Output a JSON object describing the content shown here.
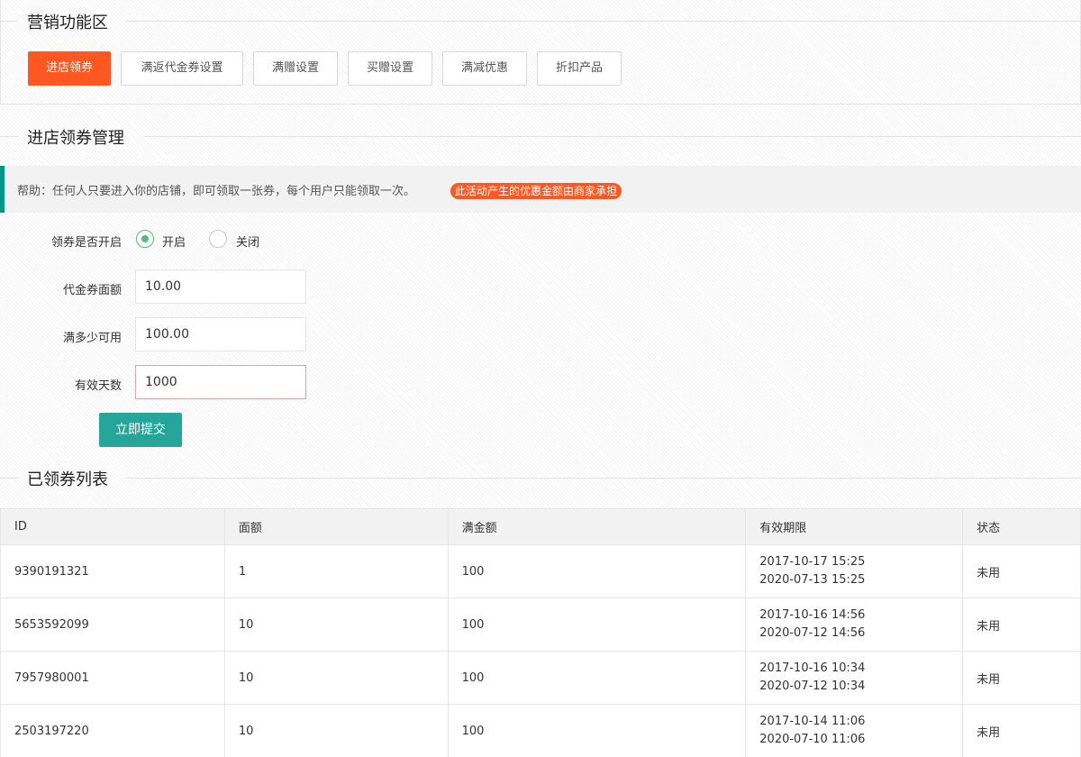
{
  "marketing": {
    "title": "营销功能区",
    "buttons": [
      {
        "label": "进店领券",
        "active": true
      },
      {
        "label": "满返代金券设置",
        "active": false
      },
      {
        "label": "满赠设置",
        "active": false
      },
      {
        "label": "买赠设置",
        "active": false
      },
      {
        "label": "满减优惠",
        "active": false
      },
      {
        "label": "折扣产品",
        "active": false
      }
    ]
  },
  "management": {
    "title": "进店领券管理",
    "help_text": "帮助：任何人只要进入你的店铺，即可领取一张券，每个用户只能领取一次。",
    "help_badge": "此活动产生的优惠金额由商家承担"
  },
  "form": {
    "enable_label": "领券是否开启",
    "option_on": "开启",
    "option_off": "关闭",
    "selected": "开启",
    "face_value_label": "代金券面额",
    "face_value": "10.00",
    "min_amount_label": "满多少可用",
    "min_amount": "100.00",
    "valid_days_label": "有效天数",
    "valid_days": "1000",
    "submit_label": "立即提交"
  },
  "coupon_list": {
    "title": "已领券列表",
    "columns": [
      "ID",
      "面额",
      "满金额",
      "有效期限",
      "状态"
    ],
    "rows": [
      {
        "id": "9390191321",
        "face": "1",
        "min": "100",
        "start": "2017-10-17 15:25",
        "end": "2020-07-13 15:25",
        "status": "未用"
      },
      {
        "id": "5653592099",
        "face": "10",
        "min": "100",
        "start": "2017-10-16 14:56",
        "end": "2020-07-12 14:56",
        "status": "未用"
      },
      {
        "id": "7957980001",
        "face": "10",
        "min": "100",
        "start": "2017-10-16 10:34",
        "end": "2020-07-12 10:34",
        "status": "未用"
      },
      {
        "id": "2503197220",
        "face": "10",
        "min": "100",
        "start": "2017-10-14 11:06",
        "end": "2020-07-10 11:06",
        "status": "未用"
      }
    ]
  },
  "colors": {
    "accent": "#ff5722",
    "primary": "#009688",
    "submit": "#26a69a",
    "radio": "#5fb878"
  }
}
